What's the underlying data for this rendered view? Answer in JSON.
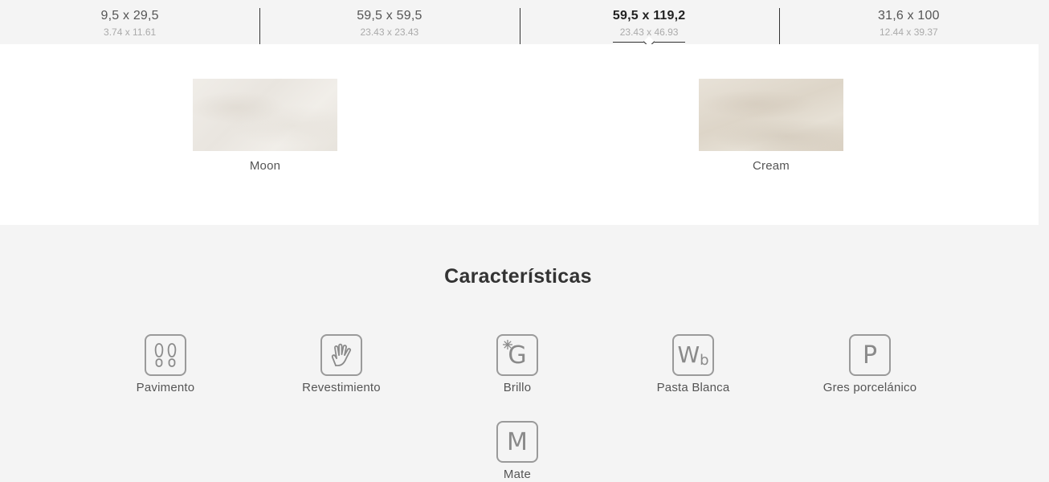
{
  "sizes": [
    {
      "metric": "9,5 x 29,5",
      "inches": "3.74 x 11.61",
      "active": false
    },
    {
      "metric": "59,5 x 59,5",
      "inches": "23.43 x 23.43",
      "active": false
    },
    {
      "metric": "59,5 x 119,2",
      "inches": "23.43 x 46.93",
      "active": true
    },
    {
      "metric": "31,6 x 100",
      "inches": "12.44 x 39.37",
      "active": false
    }
  ],
  "variants": [
    {
      "name": "Moon"
    },
    {
      "name": "Cream"
    }
  ],
  "features": {
    "title": "Características",
    "items": [
      {
        "label": "Pavimento",
        "icon": "footprints-icon"
      },
      {
        "label": "Revestimiento",
        "icon": "hand-icon"
      },
      {
        "label": "Brillo",
        "icon": "gloss-g-icon",
        "glyph": "G"
      },
      {
        "label": "Pasta Blanca",
        "icon": "white-body-wb-icon",
        "glyph": "W",
        "sub": "b"
      },
      {
        "label": "Gres porcelánico",
        "icon": "porcelain-p-icon",
        "glyph": "P"
      },
      {
        "label": "Mate",
        "icon": "matte-m-icon",
        "glyph": "M"
      }
    ]
  }
}
